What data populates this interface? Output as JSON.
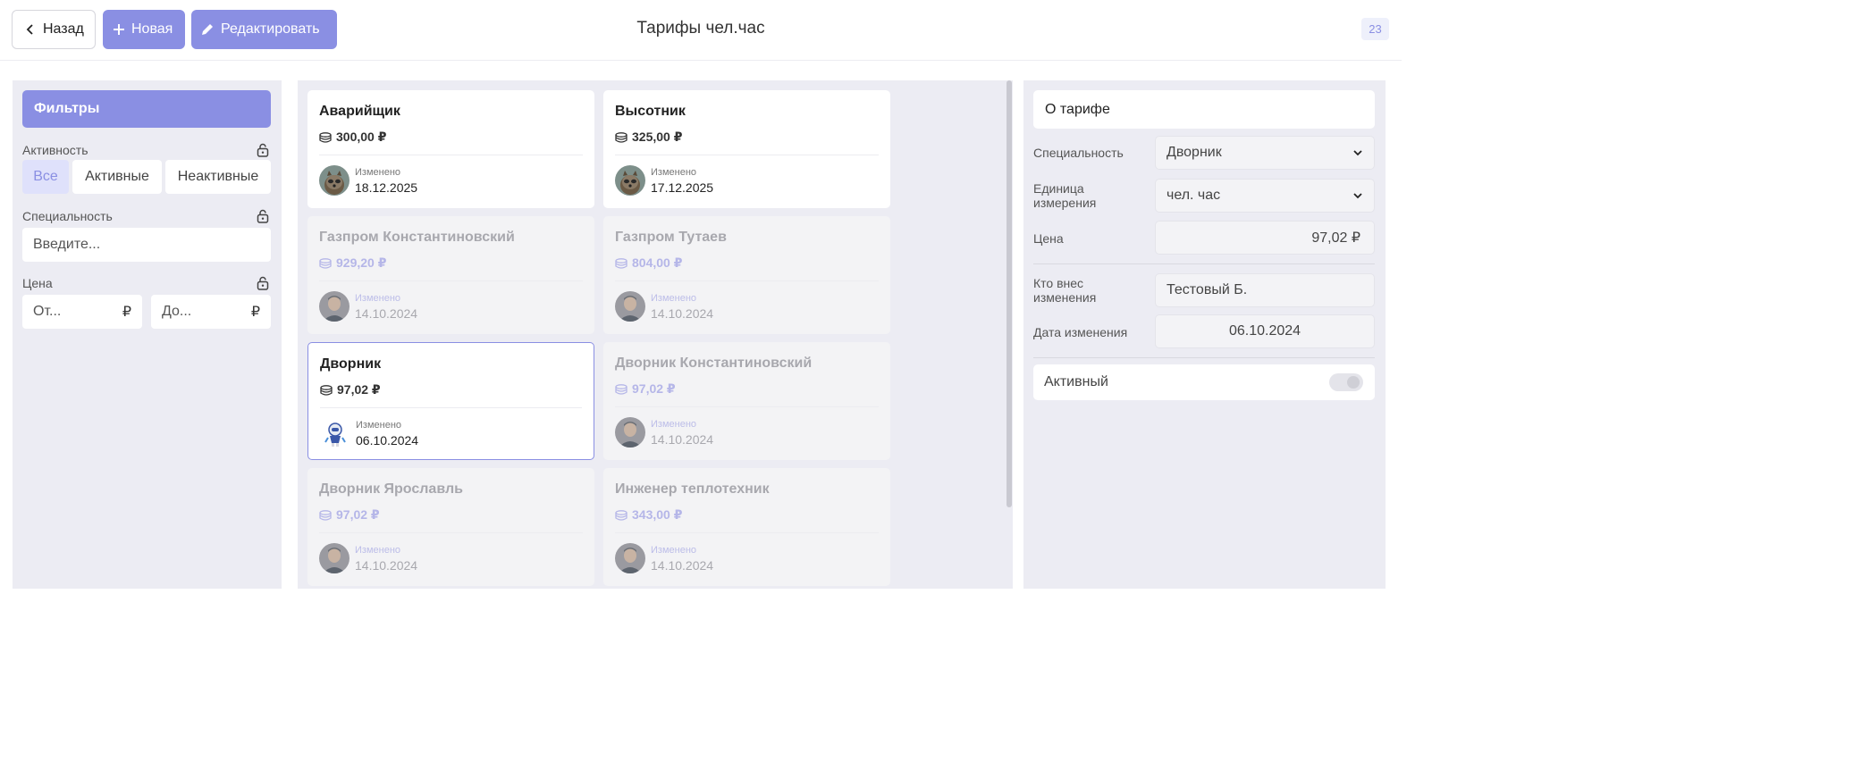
{
  "header": {
    "back_label": "Назад",
    "new_label": "Новая",
    "edit_label": "Редактировать",
    "title": "Тарифы чел.час",
    "count": "23"
  },
  "filters": {
    "title": "Фильтры",
    "activity_label": "Активность",
    "activity_options": [
      "Все",
      "Активные",
      "Неактивные"
    ],
    "activity_selected": "Все",
    "specialty_label": "Специальность",
    "specialty_placeholder": "Введите...",
    "price_label": "Цена",
    "price_from": "От...",
    "price_to": "До...",
    "currency": "₽"
  },
  "cards": [
    {
      "name": "Аварийщик",
      "price": "300,00 ₽",
      "changed_label": "Изменено",
      "date": "18.12.2025",
      "state": "active",
      "avatar": "raccoon-avatar"
    },
    {
      "name": "Высотник",
      "price": "325,00 ₽",
      "changed_label": "Изменено",
      "date": "17.12.2025",
      "state": "active",
      "avatar": "raccoon-avatar"
    },
    {
      "name": "Газпром Константиновский",
      "price": "929,20 ₽",
      "changed_label": "Изменено",
      "date": "14.10.2024",
      "state": "inactive",
      "avatar": "person-avatar"
    },
    {
      "name": "Газпром Тутаев",
      "price": "804,00 ₽",
      "changed_label": "Изменено",
      "date": "14.10.2024",
      "state": "inactive",
      "avatar": "person-avatar"
    },
    {
      "name": "Дворник",
      "price": "97,02 ₽",
      "changed_label": "Изменено",
      "date": "06.10.2024",
      "state": "selected",
      "avatar": "robot-avatar"
    },
    {
      "name": "Дворник Константиновский",
      "price": "97,02 ₽",
      "changed_label": "Изменено",
      "date": "14.10.2024",
      "state": "inactive",
      "avatar": "person-avatar"
    },
    {
      "name": "Дворник Ярославль",
      "price": "97,02 ₽",
      "changed_label": "Изменено",
      "date": "14.10.2024",
      "state": "inactive",
      "avatar": "person-avatar"
    },
    {
      "name": "Инженер теплотехник",
      "price": "343,00 ₽",
      "changed_label": "Изменено",
      "date": "14.10.2024",
      "state": "inactive",
      "avatar": "person-avatar"
    }
  ],
  "details": {
    "title": "О тарифе",
    "specialty_label": "Специальность",
    "specialty_value": "Дворник",
    "unit_label_line1": "Единица",
    "unit_label_line2": "измерения",
    "unit_value": "чел. час",
    "price_label": "Цена",
    "price_value": "97,02 ₽",
    "changed_by_label_line1": "Кто внес",
    "changed_by_label_line2": "изменения",
    "changed_by_value": "Тестовый Б.",
    "change_date_label": "Дата изменения",
    "change_date_value": "06.10.2024",
    "active_label": "Активный",
    "active_value": false
  },
  "colors": {
    "accent": "#8a8fe3",
    "panel_bg": "#ececf3",
    "inactive_text": "#a8a8ae"
  }
}
